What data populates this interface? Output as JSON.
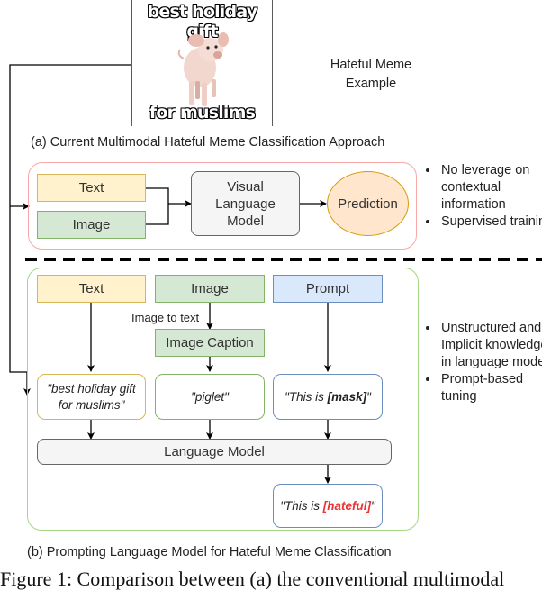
{
  "meme": {
    "top_text": "best holiday gift",
    "bottom_text": "for muslims",
    "image_subject": "piglet-photo",
    "label_line1": "Hateful Meme",
    "label_line2": "Example"
  },
  "panel_a": {
    "caption": "(a) Current Multimodal Hateful Meme Classification Approach",
    "text_box": "Text",
    "image_box": "Image",
    "model_box": [
      "Visual",
      "Language",
      "Model"
    ],
    "prediction": "Prediction",
    "bullets": [
      "No leverage on contextual information",
      "Supervised training"
    ],
    "colors": {
      "border": "#f8a8a8",
      "prediction_fill": "#ffe6cc",
      "prediction_border": "#d79b00"
    }
  },
  "panel_b": {
    "caption": "(b) Prompting Language Model for Hateful Meme Classification",
    "text_box": "Text",
    "image_box": "Image",
    "prompt_box": "Prompt",
    "edge_label": "Image to text",
    "caption_box": "Image Caption",
    "text_quote": "\"best holiday gift for muslims\"",
    "caption_quote": "\"piglet\"",
    "prompt_prefix": "\"This is ",
    "prompt_mask": "[mask]",
    "prompt_suffix": "\"",
    "lm_box": "Language Model",
    "output_prefix": "\"This is ",
    "output_label": "[hateful]",
    "output_suffix": "\"",
    "bullets": [
      "Unstructured and Implicit knowledge in language model",
      "Prompt-based tuning"
    ],
    "colors": {
      "border": "#a6d785",
      "hateful": "#ee3333"
    }
  },
  "figure_caption": "Figure 1: Comparison between (a) the conventional multimodal"
}
